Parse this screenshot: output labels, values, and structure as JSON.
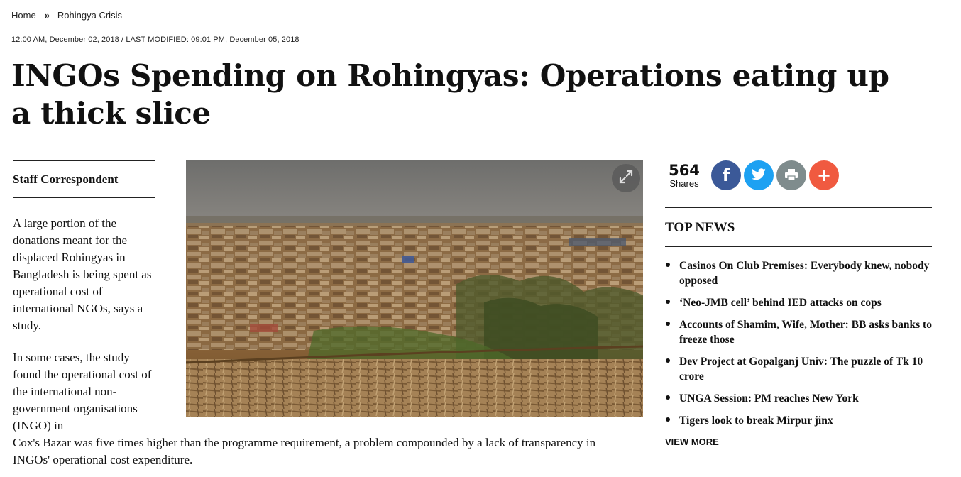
{
  "breadcrumb": {
    "home": "Home",
    "separator": "»",
    "section": "Rohingya Crisis"
  },
  "dateline": "12:00 AM, December 02, 2018 / LAST MODIFIED: 09:01 PM, December 05, 2018",
  "headline": "INGOs Spending on Rohingyas: Operations eating up a thick slice",
  "author": "Staff Correspondent",
  "body": {
    "para1": "A large portion of the donations meant for the displaced Rohingyas in Bangladesh is being spent as operational cost of international NGOs, says a study.",
    "para2_narrow": "In some cases, the study found the operational cost of the international non-government organisations (INGO) in",
    "para2_wide": "Cox's Bazar was five times higher than the programme requirement, a problem compounded by a lack of transparency in INGOs' operational cost expenditure."
  },
  "photo": {
    "icon": "expand-icon"
  },
  "shares": {
    "count": "564",
    "label": "Shares"
  },
  "social": {
    "facebook": {
      "icon": "facebook-icon",
      "color": "#3b5998"
    },
    "twitter": {
      "icon": "twitter-icon",
      "color": "#1da1f2"
    },
    "print": {
      "icon": "print-icon",
      "color": "#7f8c8d"
    },
    "more": {
      "icon": "plus-icon",
      "color": "#f05a40"
    }
  },
  "top_news": {
    "title": "TOP NEWS",
    "items": [
      "Casinos On Club Premises: Everybody knew, nobody opposed",
      "‘Neo-JMB cell’ behind IED attacks on cops",
      "Accounts of Shamim, Wife, Mother: BB asks banks to freeze those",
      "Dev Project at Gopalganj Univ: The puzzle of Tk 10 crore",
      "UNGA Session: PM reaches New York",
      "Tigers look to break Mirpur jinx"
    ],
    "view_more": "VIEW MORE"
  }
}
